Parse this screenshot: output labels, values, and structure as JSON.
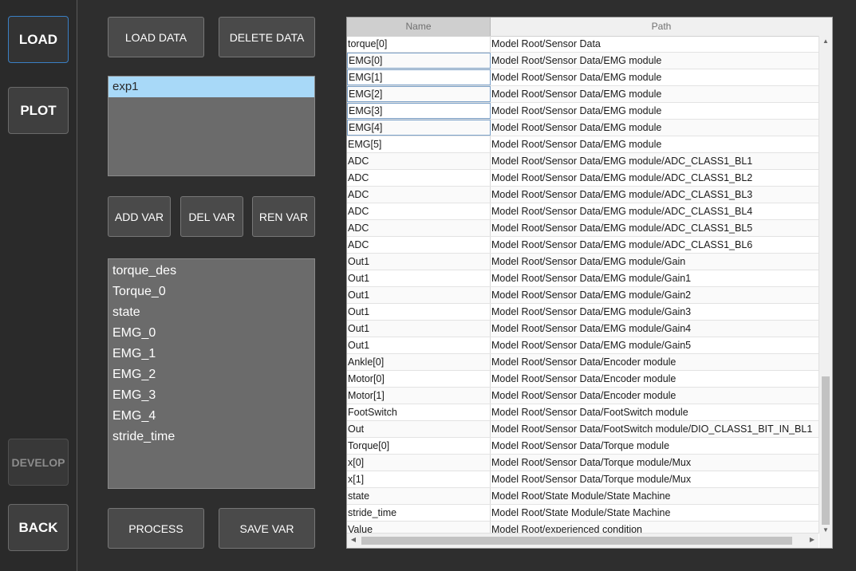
{
  "nav": {
    "load": "LOAD",
    "plot": "PLOT",
    "develop": "DEVELOP",
    "back": "BACK"
  },
  "buttons": {
    "load_data": "LOAD DATA",
    "delete_data": "DELETE DATA",
    "add_var": "ADD VAR",
    "del_var": "DEL VAR",
    "ren_var": "REN VAR",
    "process": "PROCESS",
    "save_var": "SAVE VAR"
  },
  "datasets": [
    "exp1"
  ],
  "variables": [
    "torque_des",
    "Torque_0",
    "state",
    "EMG_0",
    "EMG_1",
    "EMG_2",
    "EMG_3",
    "EMG_4",
    "stride_time"
  ],
  "table": {
    "headers": {
      "name": "Name",
      "path": "Path"
    },
    "rows": [
      {
        "name": "torque[0]",
        "path": "Model Root/Sensor Data"
      },
      {
        "name": "EMG[0]",
        "path": "Model Root/Sensor Data/EMG module"
      },
      {
        "name": "EMG[1]",
        "path": "Model Root/Sensor Data/EMG module"
      },
      {
        "name": "EMG[2]",
        "path": "Model Root/Sensor Data/EMG module"
      },
      {
        "name": "EMG[3]",
        "path": "Model Root/Sensor Data/EMG module"
      },
      {
        "name": "EMG[4]",
        "path": "Model Root/Sensor Data/EMG module"
      },
      {
        "name": "EMG[5]",
        "path": "Model Root/Sensor Data/EMG module"
      },
      {
        "name": "ADC",
        "path": "Model Root/Sensor Data/EMG module/ADC_CLASS1_BL1"
      },
      {
        "name": "ADC",
        "path": "Model Root/Sensor Data/EMG module/ADC_CLASS1_BL2"
      },
      {
        "name": "ADC",
        "path": "Model Root/Sensor Data/EMG module/ADC_CLASS1_BL3"
      },
      {
        "name": "ADC",
        "path": "Model Root/Sensor Data/EMG module/ADC_CLASS1_BL4"
      },
      {
        "name": "ADC",
        "path": "Model Root/Sensor Data/EMG module/ADC_CLASS1_BL5"
      },
      {
        "name": "ADC",
        "path": "Model Root/Sensor Data/EMG module/ADC_CLASS1_BL6"
      },
      {
        "name": "Out1",
        "path": "Model Root/Sensor Data/EMG module/Gain"
      },
      {
        "name": "Out1",
        "path": "Model Root/Sensor Data/EMG module/Gain1"
      },
      {
        "name": "Out1",
        "path": "Model Root/Sensor Data/EMG module/Gain2"
      },
      {
        "name": "Out1",
        "path": "Model Root/Sensor Data/EMG module/Gain3"
      },
      {
        "name": "Out1",
        "path": "Model Root/Sensor Data/EMG module/Gain4"
      },
      {
        "name": "Out1",
        "path": "Model Root/Sensor Data/EMG module/Gain5"
      },
      {
        "name": "Ankle[0]",
        "path": "Model Root/Sensor Data/Encoder module"
      },
      {
        "name": "Motor[0]",
        "path": "Model Root/Sensor Data/Encoder module"
      },
      {
        "name": "Motor[1]",
        "path": "Model Root/Sensor Data/Encoder module"
      },
      {
        "name": "FootSwitch",
        "path": "Model Root/Sensor Data/FootSwitch module"
      },
      {
        "name": "Out",
        "path": "Model Root/Sensor Data/FootSwitch module/DIO_CLASS1_BIT_IN_BL1"
      },
      {
        "name": "Torque[0]",
        "path": "Model Root/Sensor Data/Torque module"
      },
      {
        "name": "x[0]",
        "path": "Model Root/Sensor Data/Torque module/Mux"
      },
      {
        "name": "x[1]",
        "path": "Model Root/Sensor Data/Torque module/Mux"
      },
      {
        "name": "state",
        "path": "Model Root/State Module/State Machine"
      },
      {
        "name": "stride_time",
        "path": "Model Root/State Module/State Machine"
      },
      {
        "name": "Value",
        "path": "Model Root/experienced condition"
      }
    ]
  },
  "icons": {
    "scroll_up": "up-arrow-icon",
    "scroll_down": "down-arrow-icon",
    "scroll_left": "left-arrow-icon",
    "scroll_right": "right-arrow-icon"
  }
}
